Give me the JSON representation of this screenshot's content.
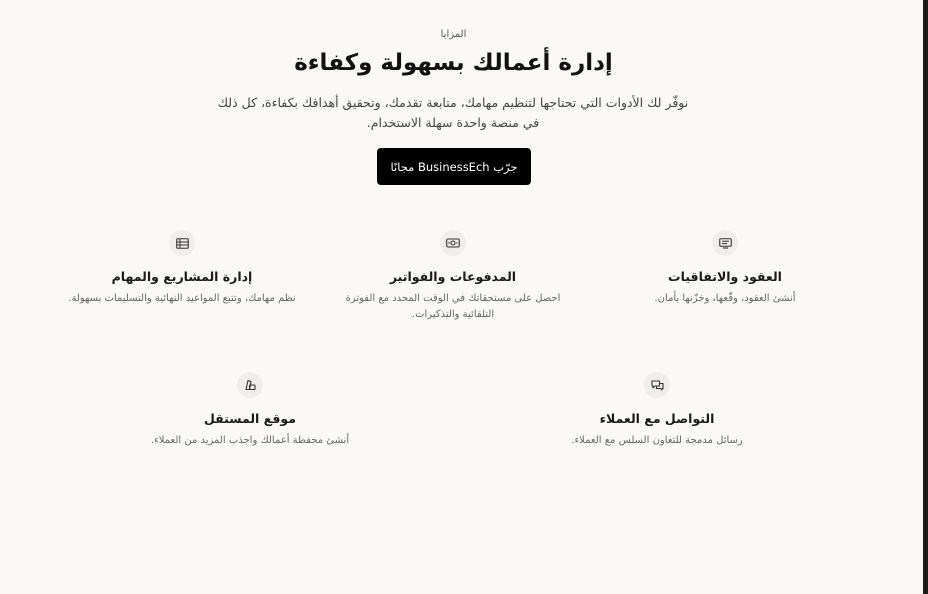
{
  "hero": {
    "eyebrow": "المزايا",
    "title": "إدارة أعمالك بسهولة وكفاءة",
    "subtitle_line1": "نوفّر لك الأدوات التي تحتاجها لتنظيم مهامك، متابعة تقدمك، وتحقيق أهدافك بكفاءة، كل ذلك",
    "subtitle_line2": "في منصة واحدة سهلة الاستخدام.",
    "cta_label": "جرّب BusinessEch مجانًا"
  },
  "features": [
    {
      "icon": "contract-icon",
      "title": "العقود والاتفاقيات",
      "desc": "أنشئ العقود، وقّعها، وخزّنها بأمان."
    },
    {
      "icon": "money-icon",
      "title": "المدفوعات والفواتير",
      "desc": "احصل على مستحقاتك في الوقت المحدد مع الفوترة التلقائية والتذكيرات."
    },
    {
      "icon": "list-icon",
      "title": "إدارة المشاريع والمهام",
      "desc": "نظم مهامك، وتتبع المواعيد النهائية والتسليمات بسهولة."
    },
    {
      "icon": "chat-icon",
      "title": "التواصل مع العملاء",
      "desc": "رسائل مدمجة للتعاون السلس مع العملاء."
    },
    {
      "icon": "portfolio-icon",
      "title": "موقع المستقل",
      "desc": "أنشئ محفظة أعمالك واجذب المزيد من العملاء."
    }
  ]
}
